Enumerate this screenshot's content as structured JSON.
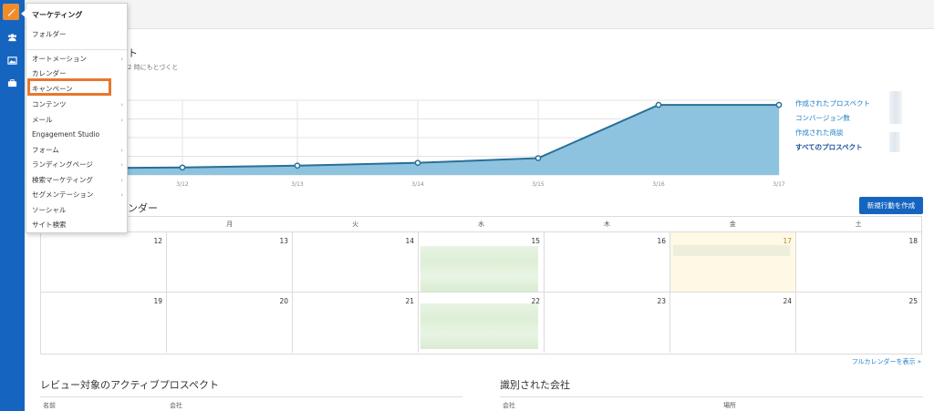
{
  "menu": {
    "header": "マーケティング",
    "folder": "フォルダー",
    "items": [
      {
        "label": "オートメーション",
        "arrow": "›"
      },
      {
        "label": "カレンダー",
        "arrow": ""
      },
      {
        "label": "キャンペーン",
        "arrow": ""
      },
      {
        "label": "コンテンツ",
        "arrow": "›"
      },
      {
        "label": "メール",
        "arrow": "›"
      },
      {
        "label": "Engagement Studio",
        "arrow": ""
      },
      {
        "label": "フォーム",
        "arrow": "›"
      },
      {
        "label": "ランディングページ",
        "arrow": "›"
      },
      {
        "label": "検索マーケティング",
        "arrow": "›"
      },
      {
        "label": "セグメンテーション",
        "arrow": "›"
      },
      {
        "label": "ソーシャル",
        "arrow": ""
      },
      {
        "label": "サイト検索",
        "arrow": ""
      }
    ]
  },
  "peek": {
    "title_tail": "ト",
    "subtitle_tail": "2 時にもとづくと"
  },
  "chart_data": {
    "type": "area",
    "categories": [
      "3/12",
      "3/13",
      "3/14",
      "3/15",
      "3/16",
      "3/17"
    ],
    "series": [
      {
        "name": "すべてのプロスペクト",
        "values": [
          8,
          10,
          13,
          18,
          75,
          75
        ]
      }
    ],
    "x_start_value": 7,
    "ylim": [
      0,
      80
    ],
    "grid": true,
    "legend_position": "right",
    "legend": [
      "作成されたプロスペクト",
      "コンバージョン数",
      "作成された商談",
      "すべてのプロスペクト"
    ],
    "colors": {
      "line": "#2a6f97",
      "fill": "#8dc3df"
    }
  },
  "calendar": {
    "title_tail": "ンダー",
    "new_button": "新規行動を作成",
    "weekdays": [
      "",
      "月",
      "火",
      "水",
      "木",
      "金",
      "土"
    ],
    "weeks": [
      [
        "12",
        "13",
        "14",
        "15",
        "16",
        "17",
        "18"
      ],
      [
        "19",
        "20",
        "21",
        "22",
        "23",
        "24",
        "25"
      ]
    ],
    "full_calendar_link": "フルカレンダーを表示 »"
  },
  "panels": {
    "left_title": "レビュー対象のアクティブプロスペクト",
    "left_cols": [
      "名前",
      "会社"
    ],
    "right_title": "識別された会社",
    "right_cols": [
      "会社",
      "場所"
    ]
  },
  "colors": {
    "rail": "#1565c0",
    "accent": "#f08c2b",
    "highlight": "#e8772e"
  }
}
